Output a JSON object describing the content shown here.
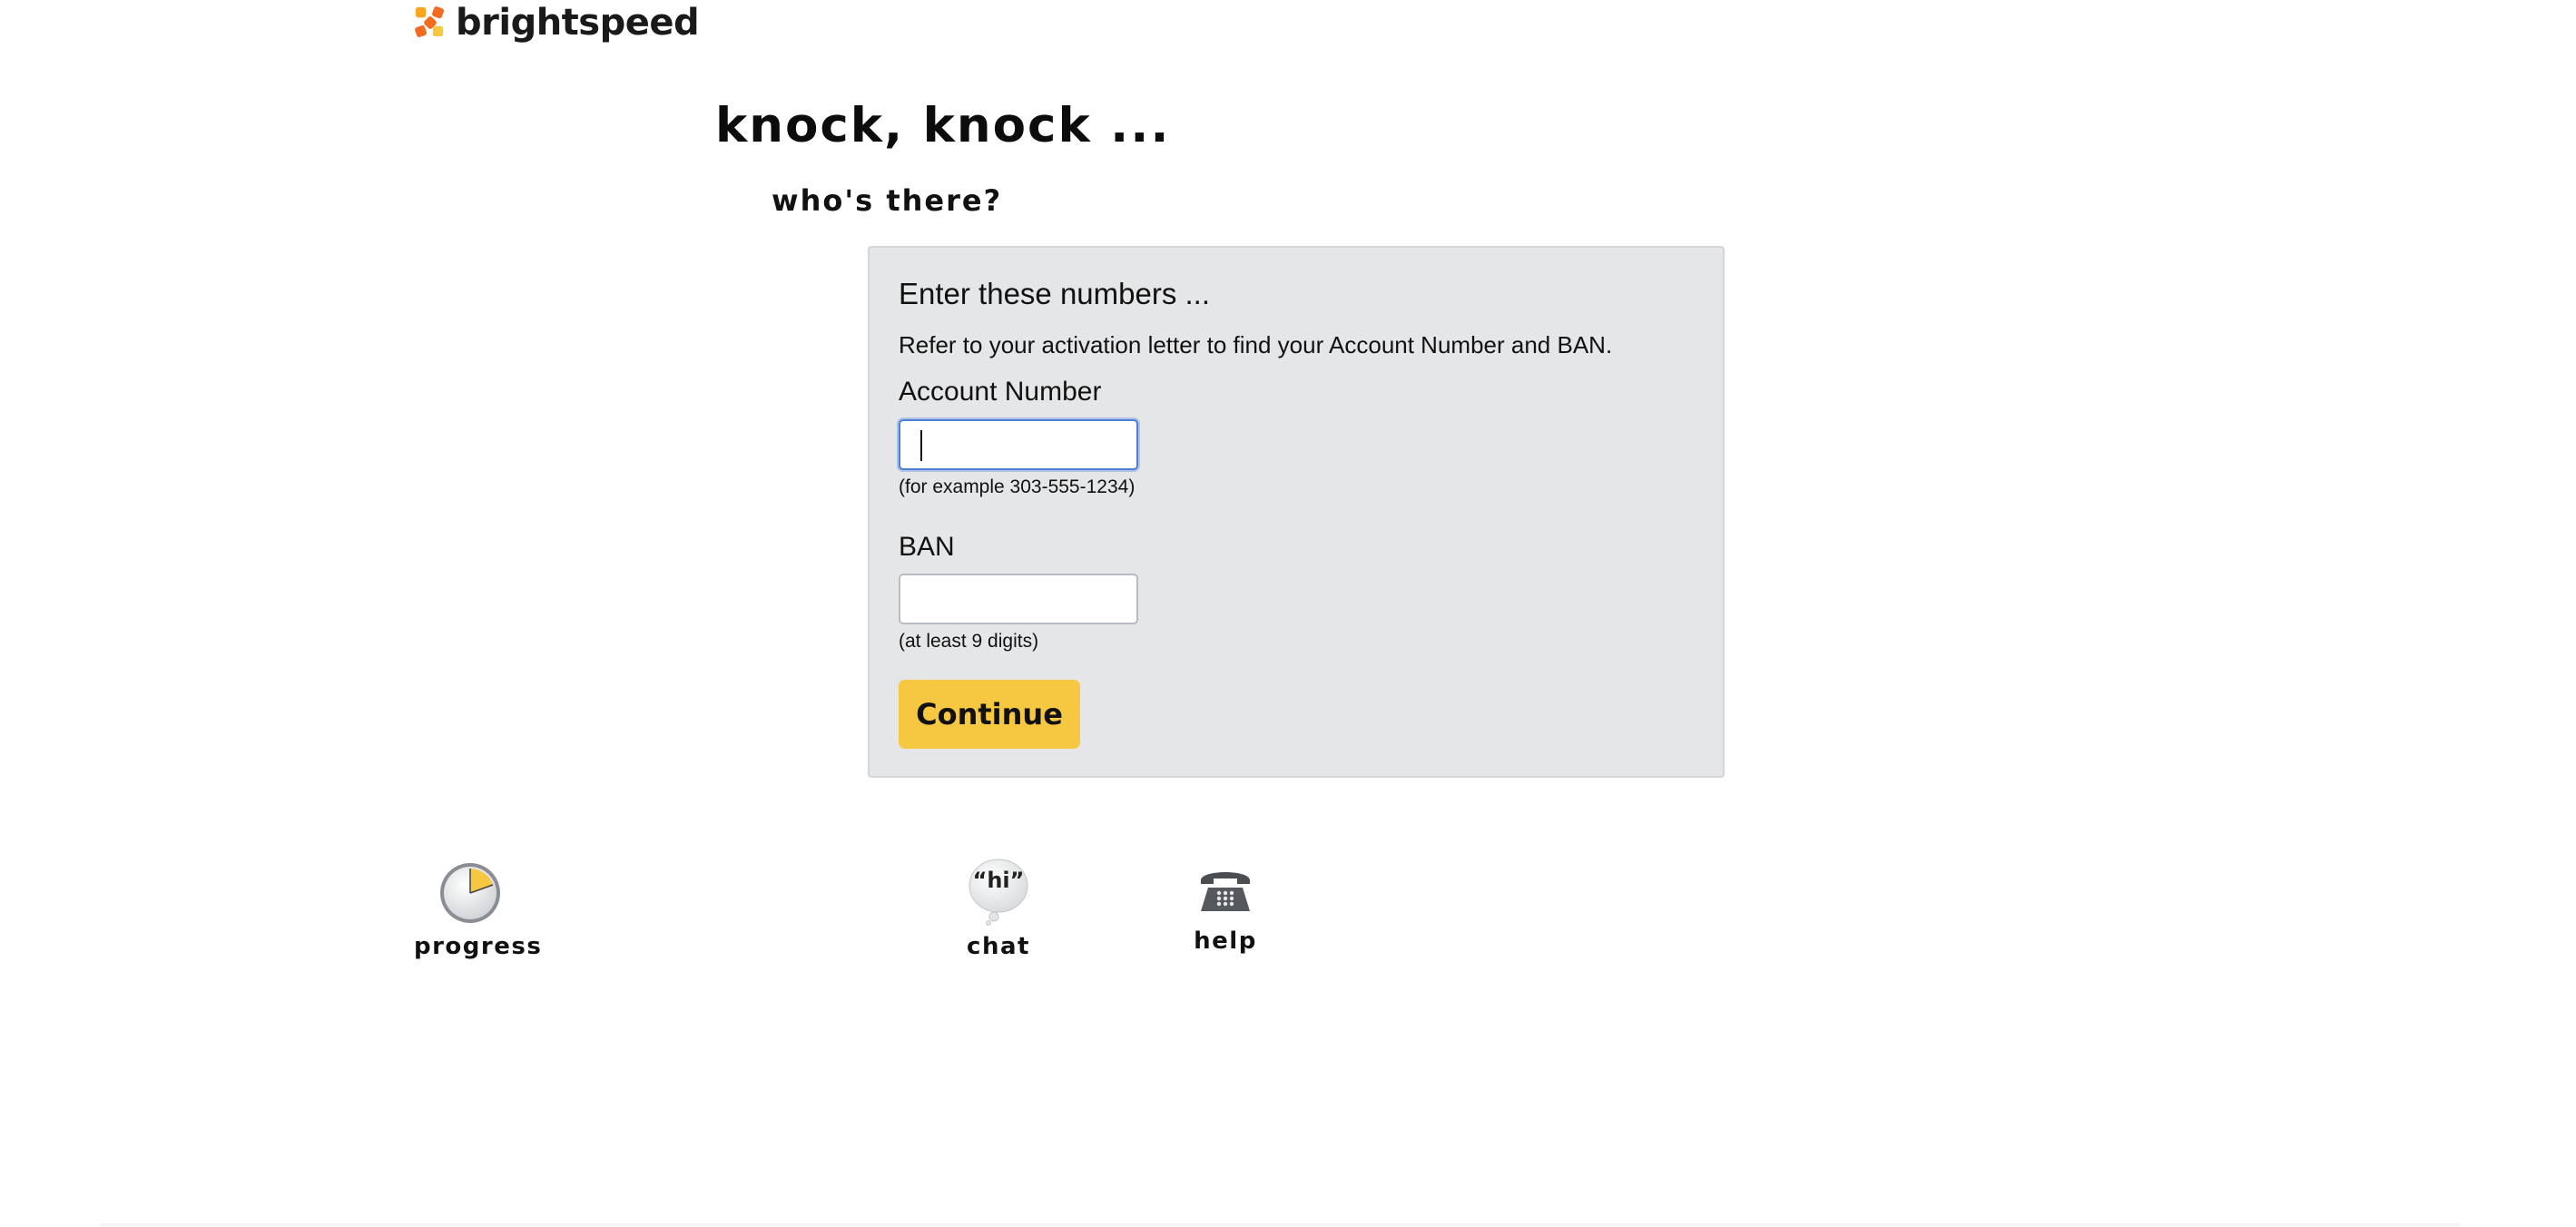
{
  "brand": {
    "name": "brightspeed"
  },
  "header": {
    "title": "knock, knock ...",
    "subtitle": "who's there?"
  },
  "form": {
    "title": "Enter these numbers ...",
    "description": "Refer to your activation letter to find your Account Number and BAN.",
    "account": {
      "label": "Account Number",
      "value": "",
      "hint": "(for example 303-555-1234)"
    },
    "ban": {
      "label": "BAN",
      "value": "",
      "hint": "(at least 9 digits)"
    },
    "continue_label": "Continue"
  },
  "tools": {
    "progress": {
      "label": "progress",
      "icon": "progress-clock-icon"
    },
    "chat": {
      "label": "chat",
      "icon": "chat-bubble-icon",
      "bubble_text": "“hi”"
    },
    "help": {
      "label": "help",
      "icon": "telephone-icon"
    }
  },
  "colors": {
    "accent": "#f6c842",
    "panel_bg": "#e5e6e8",
    "focus": "#4d7fd8",
    "logo_orange": "#f26b21",
    "logo_yellow": "#f6c842"
  }
}
